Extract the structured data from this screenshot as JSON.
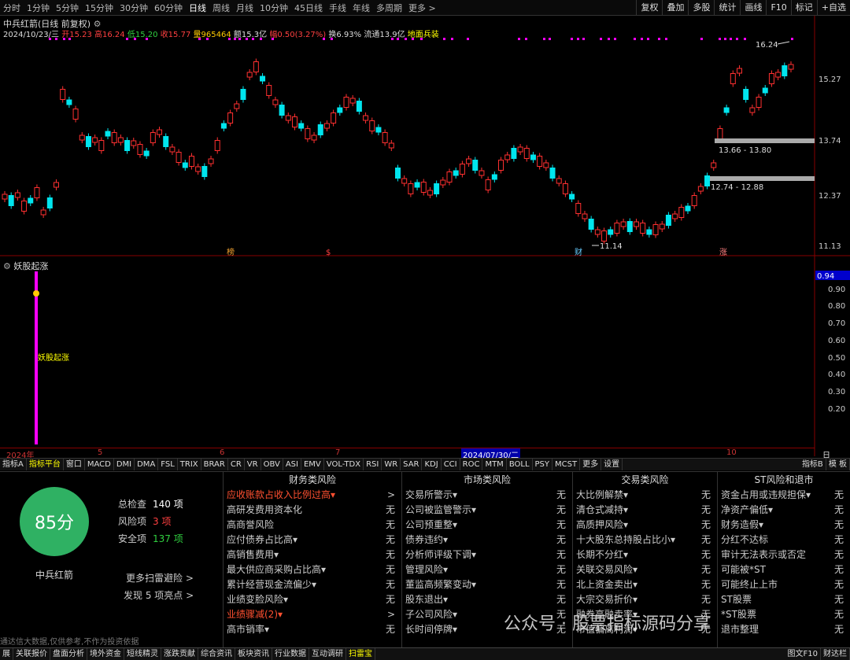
{
  "topbar": {
    "periods": [
      "分时",
      "1分钟",
      "5分钟",
      "15分钟",
      "30分钟",
      "60分钟",
      "日线",
      "周线",
      "月线",
      "10分钟",
      "45日线",
      "手线",
      "年线",
      "多周期",
      "更多 >"
    ],
    "active": "日线",
    "right_buttons": [
      "复权",
      "叠加",
      "多股",
      "统计",
      "画线",
      "F10",
      "标记",
      "+自选"
    ]
  },
  "stock": {
    "title": "中兵红箭(日线 前复权)",
    "date": "2024/10/23/三",
    "open": "开15.23",
    "high": "高16.24",
    "low": "低15.20",
    "close": "收15.77",
    "volume": "量965464",
    "amount": "额15.3亿",
    "change": "幅0.50(3.27%)",
    "turnover": "换6.93%",
    "float": "流通13.9亿",
    "tag": "地面兵装"
  },
  "main_axis": [
    "15.27",
    "13.74",
    "12.37",
    "11.13"
  ],
  "annotations": {
    "high": "16.24",
    "low": "11.14",
    "zone1": "13.66 - 13.80",
    "zone2": "12.74 - 12.88"
  },
  "markers": [
    "榜",
    "$",
    "财",
    "涨"
  ],
  "sub": {
    "title": "妖股起涨",
    "label": "妖股起涨",
    "current": "0.94",
    "axis": [
      "0.90",
      "0.80",
      "0.70",
      "0.60",
      "0.50",
      "0.40",
      "0.30",
      "0.20"
    ]
  },
  "dates": {
    "y2024": "2024年",
    "m5": "5",
    "m6": "6",
    "m7": "7",
    "cursor": "2024/07/30/二",
    "m10": "10",
    "right": "日线"
  },
  "tabs": [
    "指标A",
    "指标平台",
    "窗口",
    "MACD",
    "DMI",
    "DMA",
    "FSL",
    "TRIX",
    "BRAR",
    "CR",
    "VR",
    "OBV",
    "ASI",
    "EMV",
    "VOL-TDX",
    "RSI",
    "WR",
    "SAR",
    "KDJ",
    "CCI",
    "ROC",
    "MTM",
    "BOLL",
    "PSY",
    "MCST",
    "更多",
    "设置"
  ],
  "tabs_right": [
    "指标B",
    "模 板"
  ],
  "summary": {
    "score": "85分",
    "name": "中兵红箭",
    "total_label": "总检查",
    "total_value": "140 项",
    "risk_label": "风险项",
    "risk_value": "3 项",
    "safe_label": "安全项",
    "safe_value": "137 项",
    "more": "更多扫雷避险 >",
    "found": "发现 5 项亮点 >"
  },
  "columns": [
    {
      "title": "财务类风险",
      "rows": [
        {
          "label": "应收账款占收入比例过高▾",
          "value": ">",
          "red": true
        },
        {
          "label": "高研发费用资本化",
          "value": "无"
        },
        {
          "label": "高商誉风险",
          "value": "无"
        },
        {
          "label": "应付债券占比高▾",
          "value": "无"
        },
        {
          "label": "高销售费用▾",
          "value": "无"
        },
        {
          "label": "最大供应商采购占比高▾",
          "value": "无"
        },
        {
          "label": "累计经营现金流偏少▾",
          "value": "无"
        },
        {
          "label": "业绩变脸风险▾",
          "value": "无"
        },
        {
          "label": "业绩骤减(2)▾",
          "value": ">",
          "red": true
        },
        {
          "label": "高市销率▾",
          "value": "无"
        }
      ]
    },
    {
      "title": "市场类风险",
      "rows": [
        {
          "label": "交易所警示▾",
          "value": "无"
        },
        {
          "label": "公司被监管警示▾",
          "value": "无"
        },
        {
          "label": "公司预重整▾",
          "value": "无"
        },
        {
          "label": "债券违约▾",
          "value": "无"
        },
        {
          "label": "分析师评级下调▾",
          "value": "无"
        },
        {
          "label": "管理风险▾",
          "value": "无"
        },
        {
          "label": "董监高频繁变动▾",
          "value": "无"
        },
        {
          "label": "股东退出▾",
          "value": "无"
        },
        {
          "label": "子公司风险▾",
          "value": "无"
        },
        {
          "label": "长时间停牌▾",
          "value": "无"
        }
      ]
    },
    {
      "title": "交易类风险",
      "rows": [
        {
          "label": "大比例解禁▾",
          "value": "无"
        },
        {
          "label": "清仓式减持▾",
          "value": "无"
        },
        {
          "label": "高质押风险▾",
          "value": "无"
        },
        {
          "label": "十大股东总持股占比小▾",
          "value": "无"
        },
        {
          "label": "长期不分红▾",
          "value": "无"
        },
        {
          "label": "关联交易风险▾",
          "value": "无"
        },
        {
          "label": "北上资金卖出▾",
          "value": "无"
        },
        {
          "label": "大宗交易折价▾",
          "value": "无"
        },
        {
          "label": "融券高融卖率▾",
          "value": "无"
        },
        {
          "label": "市值偏离利润▾",
          "value": "无"
        }
      ]
    },
    {
      "title": "ST风险和退市",
      "rows": [
        {
          "label": "资金占用或违规担保▾",
          "value": "无"
        },
        {
          "label": "净资产偏低▾",
          "value": "无"
        },
        {
          "label": "财务造假▾",
          "value": "无"
        },
        {
          "label": "分红不达标",
          "value": "无"
        },
        {
          "label": "审计无法表示或否定",
          "value": "无"
        },
        {
          "label": "可能被*ST",
          "value": "无"
        },
        {
          "label": "可能终止上市",
          "value": "无"
        },
        {
          "label": "ST股票",
          "value": "无"
        },
        {
          "label": "*ST股票",
          "value": "无"
        },
        {
          "label": "退市整理",
          "value": "无"
        }
      ]
    }
  ],
  "note": "通达信大数据,仅供参考,不作为投资依据",
  "watermark": "公众号 · 股票指标源码分享",
  "bottom_tabs": [
    "展",
    "关联报价",
    "盘面分析",
    "境外资金",
    "短线精灵",
    "涨跌贡献",
    "综合资讯",
    "板块资讯",
    "行业数据",
    "互动调研",
    "扫雷宝"
  ],
  "bottom_right": [
    "图文F10",
    "财达栏"
  ],
  "colors": {
    "up": "#ff3030",
    "down": "#00e5ee",
    "magenta": "#ff00ff",
    "score_bg": "#2fb163"
  }
}
